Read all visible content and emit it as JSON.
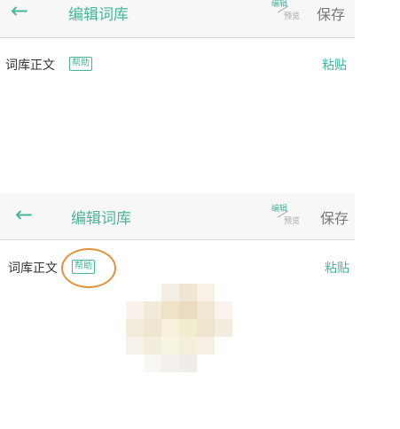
{
  "screens": [
    {
      "back_icon": "arrow-left-icon",
      "title": "编辑词库",
      "mode_edit": "编辑",
      "mode_preview": "预览",
      "save": "保存",
      "section_label": "词库正文",
      "help": "帮助",
      "paste": "粘贴"
    },
    {
      "back_icon": "arrow-left-icon",
      "title": "编辑词库",
      "mode_edit": "编辑",
      "mode_preview": "预览",
      "save": "保存",
      "section_label": "词库正文",
      "help": "帮助",
      "paste": "粘贴"
    }
  ],
  "colors": {
    "accent": "#47b59c",
    "highlight": "#e0913a",
    "app_bar_bg": "#f7f7f7"
  }
}
